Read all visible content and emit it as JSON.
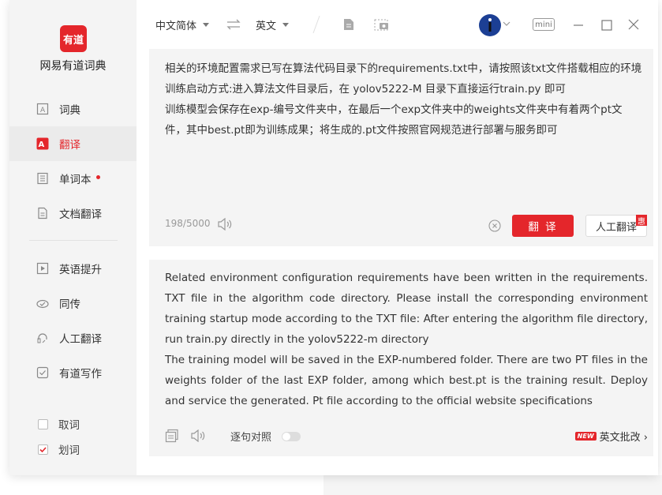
{
  "app": {
    "name": "网易有道词典",
    "logo_text": "有道"
  },
  "sidebar": {
    "items": [
      {
        "label": "词典",
        "icon": "dictionary-icon"
      },
      {
        "label": "翻译",
        "icon": "translate-icon",
        "active": true
      },
      {
        "label": "单词本",
        "icon": "wordbook-icon",
        "dot": true
      },
      {
        "label": "文档翻译",
        "icon": "document-icon"
      },
      {
        "label": "英语提升",
        "icon": "video-icon"
      },
      {
        "label": "同传",
        "icon": "interpret-icon"
      },
      {
        "label": "人工翻译",
        "icon": "headset-icon"
      },
      {
        "label": "有道写作",
        "icon": "writing-icon"
      }
    ],
    "checks": [
      {
        "label": "取词",
        "checked": false
      },
      {
        "label": "划词",
        "checked": true
      }
    ]
  },
  "topbar": {
    "source_lang": "中文简体",
    "target_lang": "英文",
    "mini_label": "mini"
  },
  "source": {
    "lines": [
      "相关的环境配置需求已写在算法代码目录下的requirements.txt中，请按照该txt文件搭载相应的环境",
      "训练启动方式:进入算法文件目录后，在 yolov5222-M 目录下直接运行train.py 即可",
      "训练模型会保存在exp-编号文件夹中，在最后一个exp文件夹中的weights文件夹中有着两个pt文",
      "件，其中best.pt即为训练成果；将生成的.pt文件按照官网规范进行部署与服务即可"
    ],
    "count": "198/5000",
    "translate_label": "翻 译",
    "human_label": "人工翻译",
    "human_badge": "惠"
  },
  "output": {
    "paragraphs": [
      "Related environment configuration requirements have been written in the requirements. TXT file in the algorithm code directory. Please install the corresponding environment training startup mode according to the TXT file: After entering the algorithm file directory, run train.py directly in the yolov5222-m directory",
      "The training model will be saved in the EXP-numbered folder. There are two PT files in the weights folder of the last EXP folder, among which best.pt is the training result. Deploy and service the generated. Pt file according to the official website specifications"
    ],
    "align_label": "逐句对照",
    "critique_badge": "NEW",
    "critique_label": "英文批改 ›"
  },
  "colors": {
    "accent": "#e4262b"
  }
}
